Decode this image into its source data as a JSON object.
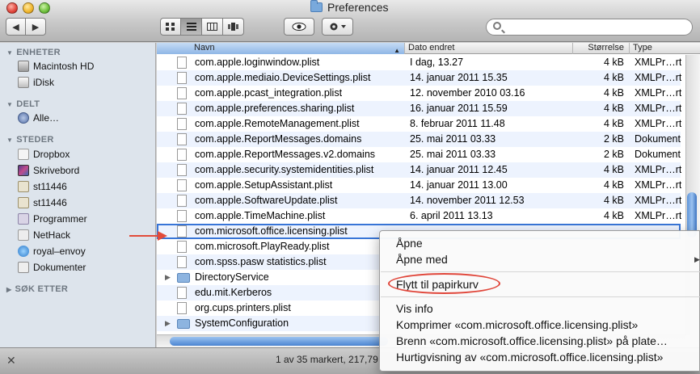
{
  "window": {
    "title": "Preferences"
  },
  "toolbar": {
    "back_icon": "◀",
    "forward_icon": "▶",
    "views": [
      "icon-view",
      "list-view",
      "column-view",
      "coverflow-view"
    ],
    "quicklook_icon": "eye",
    "action_icon": "gear",
    "search_placeholder": ""
  },
  "sidebar": {
    "sections": [
      {
        "title": "ENHETER",
        "items": [
          {
            "label": "Macintosh HD",
            "icon": "disk"
          },
          {
            "label": "iDisk",
            "icon": "idisk"
          }
        ]
      },
      {
        "title": "DELT",
        "items": [
          {
            "label": "Alle…",
            "icon": "network"
          }
        ]
      },
      {
        "title": "STEDER",
        "items": [
          {
            "label": "Dropbox",
            "icon": "dropbox"
          },
          {
            "label": "Skrivebord",
            "icon": "desktop"
          },
          {
            "label": "st11446",
            "icon": "home"
          },
          {
            "label": "st11446",
            "icon": "home"
          },
          {
            "label": "Programmer",
            "icon": "applications"
          },
          {
            "label": "NetHack",
            "icon": "app"
          },
          {
            "label": "royal–envoy",
            "icon": "globe"
          },
          {
            "label": "Dokumenter",
            "icon": "documents"
          }
        ]
      },
      {
        "title": "SØK ETTER",
        "items": []
      }
    ]
  },
  "columns": {
    "name": "Navn",
    "date": "Dato endret",
    "size": "Størrelse",
    "type": "Type"
  },
  "files": [
    {
      "name": "com.apple.loginwindow.plist",
      "date": "I dag, 13.27",
      "size": "4 kB",
      "type": "XMLPr…rty"
    },
    {
      "name": "com.apple.mediaio.DeviceSettings.plist",
      "date": "14. januar 2011 15.35",
      "size": "4 kB",
      "type": "XMLPr…rty"
    },
    {
      "name": "com.apple.pcast_integration.plist",
      "date": "12. november 2010 03.16",
      "size": "4 kB",
      "type": "XMLPr…rty"
    },
    {
      "name": "com.apple.preferences.sharing.plist",
      "date": "16. januar 2011 15.59",
      "size": "4 kB",
      "type": "XMLPr…rty"
    },
    {
      "name": "com.apple.RemoteManagement.plist",
      "date": "8. februar 2011 11.48",
      "size": "4 kB",
      "type": "XMLPr…rty"
    },
    {
      "name": "com.apple.ReportMessages.domains",
      "date": "25. mai 2011 03.33",
      "size": "2 kB",
      "type": "Dokument"
    },
    {
      "name": "com.apple.ReportMessages.v2.domains",
      "date": "25. mai 2011 03.33",
      "size": "2 kB",
      "type": "Dokument"
    },
    {
      "name": "com.apple.security.systemidentities.plist",
      "date": "14. januar 2011 12.45",
      "size": "4 kB",
      "type": "XMLPr…rty"
    },
    {
      "name": "com.apple.SetupAssistant.plist",
      "date": "14. januar 2011 13.00",
      "size": "4 kB",
      "type": "XMLPr…rty"
    },
    {
      "name": "com.apple.SoftwareUpdate.plist",
      "date": "14. november 2011 12.53",
      "size": "4 kB",
      "type": "XMLPr…rty"
    },
    {
      "name": "com.apple.TimeMachine.plist",
      "date": "6. april 2011 13.13",
      "size": "4 kB",
      "type": "XMLPr…rty"
    },
    {
      "name": "com.microsoft.office.licensing.plist",
      "date": "",
      "size": "",
      "type": "",
      "selected": true
    },
    {
      "name": "com.microsoft.PlayReady.plist",
      "date": "",
      "size": "",
      "type": ""
    },
    {
      "name": "com.spss.pasw statistics.plist",
      "date": "",
      "size": "",
      "type": ""
    },
    {
      "name": "DirectoryService",
      "date": "",
      "size": "",
      "type": "",
      "folder": true
    },
    {
      "name": "edu.mit.Kerberos",
      "date": "",
      "size": "",
      "type": ""
    },
    {
      "name": "org.cups.printers.plist",
      "date": "",
      "size": "",
      "type": ""
    },
    {
      "name": "SystemConfiguration",
      "date": "",
      "size": "",
      "type": "",
      "folder": true
    }
  ],
  "status": {
    "text": "1 av 35 markert, 217,79"
  },
  "context_menu": {
    "items": [
      {
        "label": "Åpne",
        "group": 0
      },
      {
        "label": "Åpne med",
        "group": 0,
        "submenu": true
      },
      {
        "label": "Flytt til papirkurv",
        "group": 1,
        "highlighted": true
      },
      {
        "label": "Vis info",
        "group": 2
      },
      {
        "label": "Komprimer «com.microsoft.office.licensing.plist»",
        "group": 2
      },
      {
        "label": "Brenn «com.microsoft.office.licensing.plist» på plate…",
        "group": 2
      },
      {
        "label": "Hurtigvisning av «com.microsoft.office.licensing.plist»",
        "group": 2
      }
    ]
  },
  "colors": {
    "selection": "#3875d7",
    "annotation": "#e24b3a",
    "row_alt": "#edf3fe"
  }
}
